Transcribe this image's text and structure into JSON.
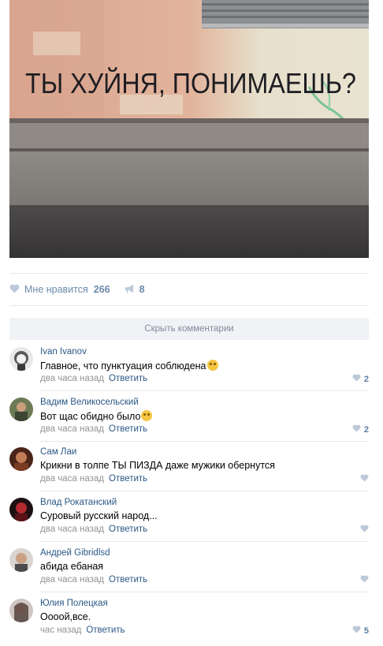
{
  "post": {
    "photo_graffiti": "ТЫ ХУЙНЯ, ПОНИМАЕШЬ?",
    "likes_label": "Мне нравится",
    "likes_count": "266",
    "shares_count": "8"
  },
  "hide_comments_label": "Скрыть комментарии",
  "comments": [
    {
      "author": "Ivan Ivanov",
      "text": "Главное, что пунктуация соблюдена",
      "time": "два часа назад",
      "reply": "Ответить",
      "likes": "2",
      "emoji": "flushed-emoji"
    },
    {
      "author": "Вадим Великосельский",
      "text": "Вот щас обидно было",
      "time": "два часа назад",
      "reply": "Ответить",
      "likes": "2",
      "emoji": "pensive-emoji"
    },
    {
      "author": "Сам Лаи",
      "text": "Крикни в толпе ТЫ ПИЗДА даже мужики обернутся",
      "time": "два часа назад",
      "reply": "Ответить",
      "likes": ""
    },
    {
      "author": "Влад Рокатанский",
      "text": "Суровый русский народ...",
      "time": "два часа назад",
      "reply": "Ответить",
      "likes": ""
    },
    {
      "author": "Андрей Gibridlsd",
      "text": "абида ебаная",
      "time": "два часа назад",
      "reply": "Ответить",
      "likes": ""
    },
    {
      "author": "Юлия Полецкая",
      "text": "Оооой,все.",
      "time": "час назад",
      "reply": "Ответить",
      "likes": "5"
    }
  ],
  "colors": {
    "link": "#2a5885",
    "meta": "#939393",
    "action": "#6b8aab",
    "separator": "#e7e8ec"
  }
}
